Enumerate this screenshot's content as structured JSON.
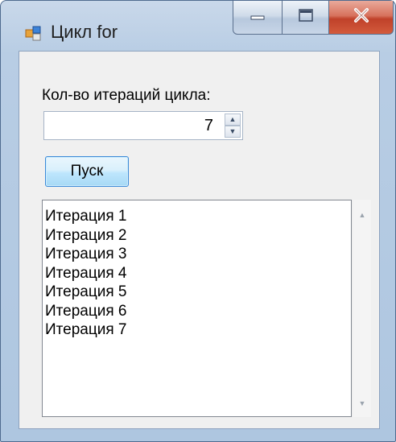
{
  "window": {
    "title": "Цикл for",
    "icon": "form-icon"
  },
  "title_controls": {
    "minimize": "minimize-icon",
    "maximize": "maximize-icon",
    "close": "close-icon"
  },
  "form": {
    "iterations_label": "Кол-во итераций цикла:",
    "iterations_value": "7",
    "spin_up": "▲",
    "spin_down": "▼",
    "run_button": "Пуск"
  },
  "list": {
    "items": [
      "Итерация 1",
      "Итерация 2",
      "Итерация 3",
      "Итерация 4",
      "Итерация 5",
      "Итерация 6",
      "Итерация 7"
    ],
    "scroll_up": "▲",
    "scroll_down": "▼"
  },
  "colors": {
    "window_frame": "#aec6e0",
    "close_button": "#c0412a",
    "button_accent": "#3c8ad8"
  }
}
